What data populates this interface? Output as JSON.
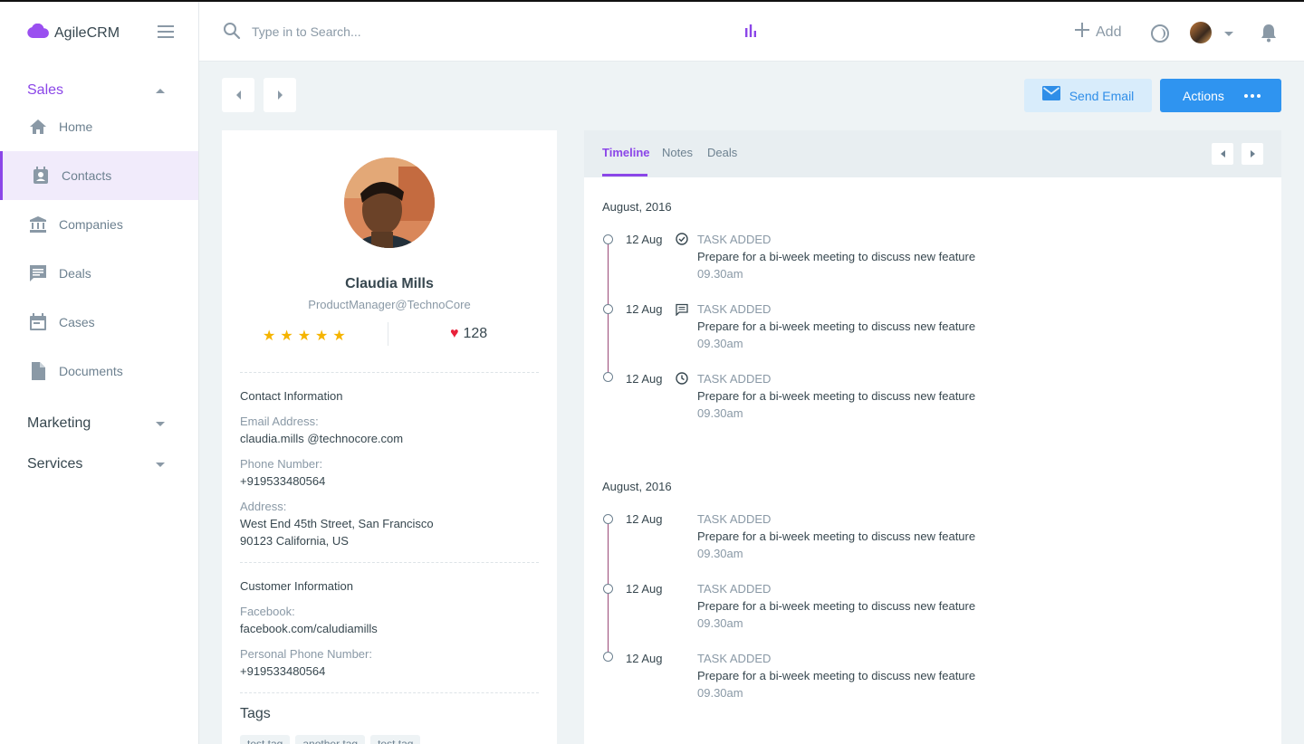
{
  "app": {
    "name": "AgileCRM"
  },
  "colors": {
    "accent": "#8b46e8",
    "primary": "#2f94f0",
    "star": "#f5b400",
    "heart": "#e8213a"
  },
  "sidebar": {
    "sections": [
      {
        "label": "Sales",
        "expanded": true
      },
      {
        "label": "Marketing",
        "expanded": false
      },
      {
        "label": "Services",
        "expanded": false
      }
    ],
    "items": [
      {
        "label": "Home",
        "icon": "home-icon"
      },
      {
        "label": "Contacts",
        "icon": "contacts-icon",
        "active": true
      },
      {
        "label": "Companies",
        "icon": "bank-icon"
      },
      {
        "label": "Deals",
        "icon": "chat-icon"
      },
      {
        "label": "Cases",
        "icon": "calendar-icon"
      },
      {
        "label": "Documents",
        "icon": "document-icon"
      }
    ]
  },
  "topbar": {
    "search_placeholder": "Type in to Search...",
    "add_label": "Add"
  },
  "toolbar": {
    "send_email_label": "Send Email",
    "actions_label": "Actions"
  },
  "profile": {
    "name": "Claudia Mills",
    "title": "ProductManager@TechnoCore",
    "rating": 5,
    "likes": "128",
    "contact_section_title": "Contact Information",
    "email_label": "Email Address:",
    "email": "claudia.mills @technocore.com",
    "phone_label": "Phone Number:",
    "phone": "+919533480564",
    "address_label": "Address:",
    "address_line1": "West End 45th Street, San Francisco",
    "address_line2": "90123 California, US",
    "customer_section_title": "Customer Information",
    "facebook_label": "Facebook:",
    "facebook": "facebook.com/caludiamills",
    "personal_phone_label": "Personal Phone Number:",
    "personal_phone": "+919533480564",
    "tags_title": "Tags",
    "tags": [
      "test tag",
      "another tag",
      "test tag"
    ]
  },
  "timeline": {
    "tabs": [
      {
        "label": "Timeline",
        "active": true
      },
      {
        "label": "Notes"
      },
      {
        "label": "Deals"
      }
    ],
    "groups": [
      {
        "month": "August, 2016",
        "events": [
          {
            "date": "12 Aug",
            "icon": "task-check-icon",
            "type": "TASK ADDED",
            "text": "Prepare for a bi-week meeting to discuss new feature",
            "time": "09.30am"
          },
          {
            "date": "12 Aug",
            "icon": "comment-icon",
            "type": "TASK ADDED",
            "text": "Prepare for a bi-week meeting to discuss new feature",
            "time": "09.30am"
          },
          {
            "date": "12 Aug",
            "icon": "clock-icon",
            "type": "TASK ADDED",
            "text": "Prepare for a bi-week meeting to discuss new feature",
            "time": "09.30am"
          }
        ]
      },
      {
        "month": "August, 2016",
        "events": [
          {
            "date": "12 Aug",
            "type": "TASK ADDED",
            "text": "Prepare for a bi-week meeting to discuss new feature",
            "time": "09.30am"
          },
          {
            "date": "12 Aug",
            "type": "TASK ADDED",
            "text": "Prepare for a bi-week meeting to discuss new feature",
            "time": "09.30am"
          },
          {
            "date": "12 Aug",
            "type": "TASK ADDED",
            "text": "Prepare for a bi-week meeting to discuss new feature",
            "time": "09.30am"
          }
        ]
      }
    ]
  }
}
